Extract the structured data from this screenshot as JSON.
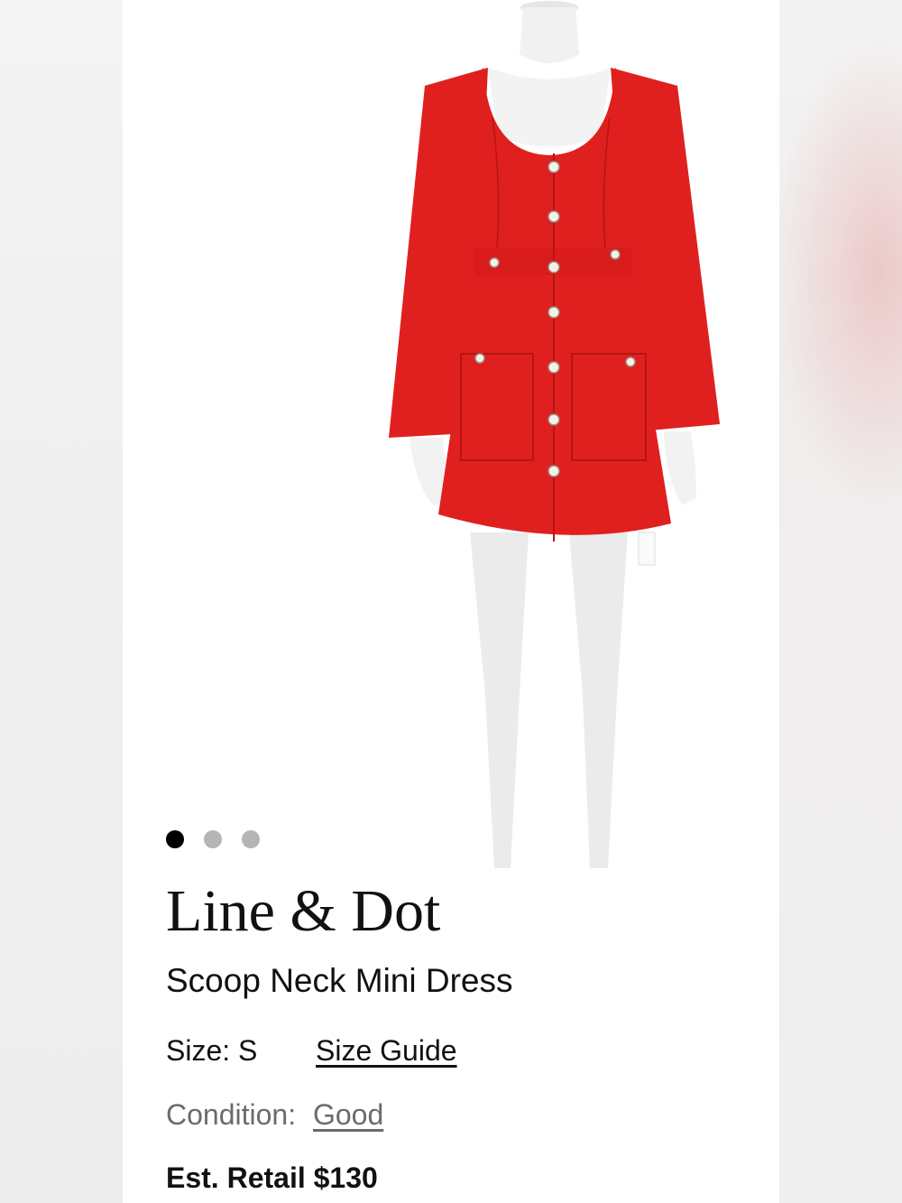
{
  "product": {
    "brand": "Line & Dot",
    "name": "Scoop Neck Mini Dress",
    "size_label": "Size:",
    "size_value": "S",
    "size_guide_label": "Size Guide",
    "condition_label": "Condition:",
    "condition_value": "Good",
    "retail_label": "Est. Retail",
    "retail_price": "$130"
  },
  "carousel": {
    "image_count": 3,
    "active_index": 0
  },
  "colors": {
    "dress": "#e0201f",
    "dot_active": "#000000",
    "dot_inactive": "#b5b5b5"
  }
}
